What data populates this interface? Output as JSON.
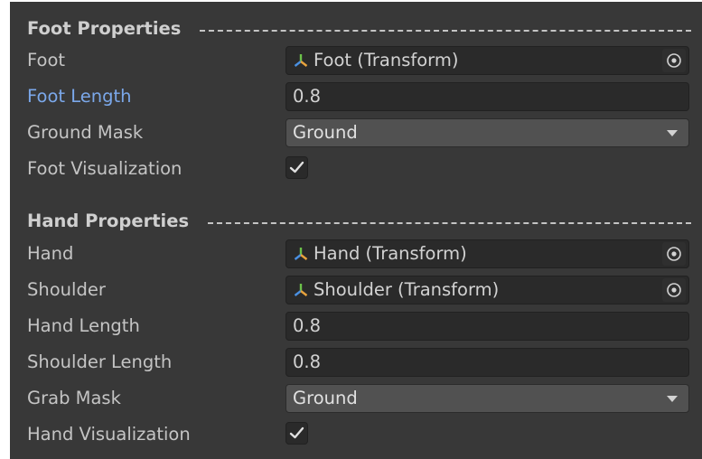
{
  "foot_section": {
    "title": "Foot Properties",
    "foot": {
      "label": "Foot",
      "value": "Foot (Transform)"
    },
    "foot_length": {
      "label": "Foot Length",
      "value": "0.8"
    },
    "ground_mask": {
      "label": "Ground Mask",
      "value": "Ground"
    },
    "foot_visualization": {
      "label": "Foot Visualization",
      "checked": true
    }
  },
  "hand_section": {
    "title": "Hand Properties",
    "hand": {
      "label": "Hand",
      "value": "Hand (Transform)"
    },
    "shoulder": {
      "label": "Shoulder",
      "value": "Shoulder (Transform)"
    },
    "hand_length": {
      "label": "Hand Length",
      "value": "0.8"
    },
    "shoulder_length": {
      "label": "Shoulder Length",
      "value": "0.8"
    },
    "grab_mask": {
      "label": "Grab Mask",
      "value": "Ground"
    },
    "hand_visualization": {
      "label": "Hand Visualization",
      "checked": true
    }
  },
  "icons": {
    "transform": "transform-axes-icon",
    "object_picker": "object-picker-icon",
    "dropdown": "dropdown-caret-icon",
    "checkmark": "checkmark-icon"
  },
  "colors": {
    "panel_bg": "#383838",
    "label": "#c4c4c4",
    "active_label": "#7ba8ea",
    "field_bg": "#2a2a2a",
    "dropdown_bg": "#515151"
  }
}
